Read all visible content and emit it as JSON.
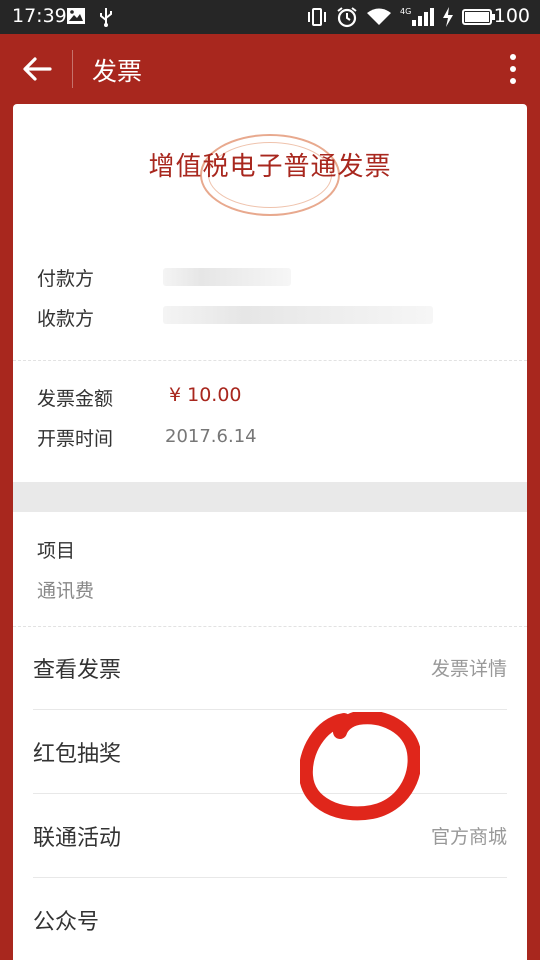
{
  "status_bar": {
    "time": "17:39",
    "battery": "100",
    "battery_level": 1.0,
    "left_icons": [
      "image-icon",
      "usb-icon"
    ],
    "right_icons": [
      "vibrate-icon",
      "alarm-icon",
      "wifi-icon",
      "4g-signal-icon",
      "charging-icon",
      "battery-icon"
    ]
  },
  "app_bar": {
    "title": "发票"
  },
  "invoice": {
    "title": "增值税电子普通发票",
    "payer_label": "付款方",
    "payee_label": "收款方",
    "amount_label": "发票金额",
    "amount_value": "¥ 10.00",
    "date_label": "开票时间",
    "date_value": "2017.6.14",
    "item_label": "项目",
    "item_value": "通讯费"
  },
  "menu": [
    {
      "label": "查看发票",
      "value": "发票详情"
    },
    {
      "label": "红包抽奖",
      "value": ""
    },
    {
      "label": "联通活动",
      "value": "官方商城"
    },
    {
      "label": "公众号",
      "value": ""
    }
  ],
  "colors": {
    "brand_red": "#a8271e",
    "status_bar": "#262626",
    "annotation_red": "#e0261b"
  }
}
